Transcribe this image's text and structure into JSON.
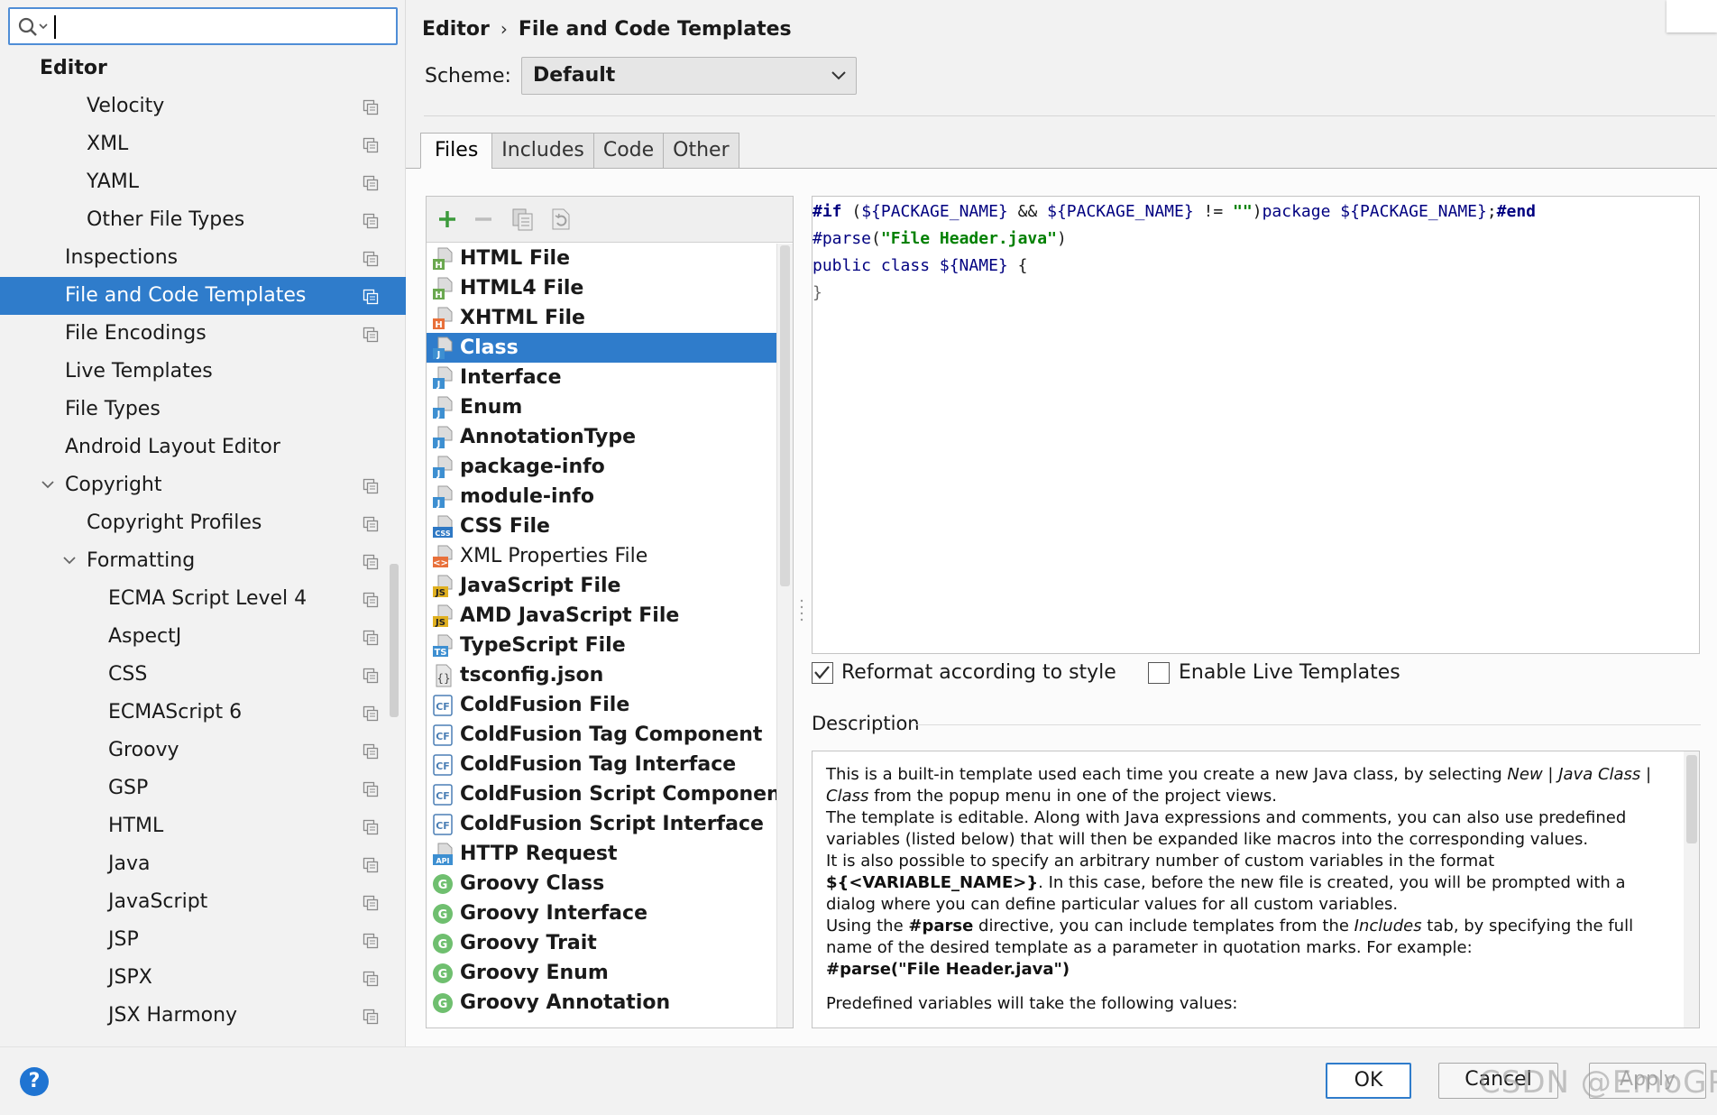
{
  "search": {
    "value": ""
  },
  "sidebar": {
    "items": [
      {
        "label": "Editor",
        "bold": true,
        "indent": 1,
        "proj": false
      },
      {
        "label": "Velocity",
        "indent": 3,
        "proj": true
      },
      {
        "label": "XML",
        "indent": 3,
        "proj": true
      },
      {
        "label": "YAML",
        "indent": 3,
        "proj": true
      },
      {
        "label": "Other File Types",
        "indent": 3,
        "proj": true
      },
      {
        "label": "Inspections",
        "indent": 2,
        "proj": true
      },
      {
        "label": "File and Code Templates",
        "indent": 2,
        "proj": true,
        "selected": true
      },
      {
        "label": "File Encodings",
        "indent": 2,
        "proj": true
      },
      {
        "label": "Live Templates",
        "indent": 2,
        "proj": false
      },
      {
        "label": "File Types",
        "indent": 2,
        "proj": false
      },
      {
        "label": "Android Layout Editor",
        "indent": 2,
        "proj": false
      },
      {
        "label": "Copyright",
        "indent": 2,
        "proj": true,
        "expanded": true
      },
      {
        "label": "Copyright Profiles",
        "indent": 3,
        "proj": true
      },
      {
        "label": "Formatting",
        "indent": 3,
        "proj": true,
        "expanded": true
      },
      {
        "label": "ECMA Script Level 4",
        "indent": 4,
        "proj": true
      },
      {
        "label": "AspectJ",
        "indent": 4,
        "proj": true
      },
      {
        "label": "CSS",
        "indent": 4,
        "proj": true
      },
      {
        "label": "ECMAScript 6",
        "indent": 4,
        "proj": true
      },
      {
        "label": "Groovy",
        "indent": 4,
        "proj": true
      },
      {
        "label": "GSP",
        "indent": 4,
        "proj": true
      },
      {
        "label": "HTML",
        "indent": 4,
        "proj": true
      },
      {
        "label": "Java",
        "indent": 4,
        "proj": true
      },
      {
        "label": "JavaScript",
        "indent": 4,
        "proj": true
      },
      {
        "label": "JSP",
        "indent": 4,
        "proj": true
      },
      {
        "label": "JSPX",
        "indent": 4,
        "proj": true
      },
      {
        "label": "JSX Harmony",
        "indent": 4,
        "proj": true
      }
    ]
  },
  "header": {
    "breadcrumb": [
      "Editor",
      "File and Code Templates"
    ],
    "breadcrumb_sep": "›",
    "scheme_label": "Scheme:",
    "scheme_value": "Default"
  },
  "tabs": [
    {
      "label": "Files",
      "active": true
    },
    {
      "label": "Includes"
    },
    {
      "label": "Code"
    },
    {
      "label": "Other"
    }
  ],
  "templates": [
    {
      "name": "HTML File",
      "icon": "html-file-icon",
      "badge": "H",
      "color": "#6aa84f"
    },
    {
      "name": "HTML4 File",
      "icon": "html-file-icon",
      "badge": "H",
      "color": "#6aa84f"
    },
    {
      "name": "XHTML File",
      "icon": "xhtml-file-icon",
      "badge": "H",
      "color": "#e8703a"
    },
    {
      "name": "Class",
      "icon": "java-file-icon",
      "badge": "J",
      "color": "#3d8fd1",
      "selected": true
    },
    {
      "name": "Interface",
      "icon": "java-file-icon",
      "badge": "J",
      "color": "#3d8fd1"
    },
    {
      "name": "Enum",
      "icon": "java-file-icon",
      "badge": "J",
      "color": "#3d8fd1"
    },
    {
      "name": "AnnotationType",
      "icon": "java-file-icon",
      "badge": "J",
      "color": "#3d8fd1"
    },
    {
      "name": "package-info",
      "icon": "java-file-icon",
      "badge": "J",
      "color": "#3d8fd1"
    },
    {
      "name": "module-info",
      "icon": "java-file-icon",
      "badge": "J",
      "color": "#3d8fd1"
    },
    {
      "name": "CSS File",
      "icon": "css-file-icon",
      "badge": "CSS",
      "color": "#2e78c4"
    },
    {
      "name": "XML Properties File",
      "icon": "xml-file-icon",
      "badge": "<>",
      "color": "#e8703a",
      "plain": true
    },
    {
      "name": "JavaScript File",
      "icon": "js-file-icon",
      "badge": "JS",
      "color": "#e0b020"
    },
    {
      "name": "AMD JavaScript File",
      "icon": "js-file-icon",
      "badge": "JS",
      "color": "#e0b020"
    },
    {
      "name": "TypeScript File",
      "icon": "ts-file-icon",
      "badge": "TS",
      "color": "#3d8fd1"
    },
    {
      "name": "tsconfig.json",
      "icon": "json-file-icon",
      "badge": "{}",
      "color": "#777777"
    },
    {
      "name": "ColdFusion File",
      "icon": "coldfusion-icon",
      "badge": "CF",
      "color": "#4b7fb5"
    },
    {
      "name": "ColdFusion Tag Component",
      "icon": "coldfusion-icon",
      "badge": "CF",
      "color": "#4b7fb5"
    },
    {
      "name": "ColdFusion Tag Interface",
      "icon": "coldfusion-icon",
      "badge": "CF",
      "color": "#4b7fb5"
    },
    {
      "name": "ColdFusion Script Component",
      "icon": "coldfusion-icon",
      "badge": "CF",
      "color": "#4b7fb5"
    },
    {
      "name": "ColdFusion Script Interface",
      "icon": "coldfusion-icon",
      "badge": "CF",
      "color": "#4b7fb5"
    },
    {
      "name": "HTTP Request",
      "icon": "http-request-icon",
      "badge": "API",
      "color": "#3d8fd1"
    },
    {
      "name": "Groovy Class",
      "icon": "groovy-icon",
      "badge": "G",
      "color": "#6fbf6f",
      "round": true
    },
    {
      "name": "Groovy Interface",
      "icon": "groovy-icon",
      "badge": "G",
      "color": "#6fbf6f",
      "round": true
    },
    {
      "name": "Groovy Trait",
      "icon": "groovy-icon",
      "badge": "G",
      "color": "#6fbf6f",
      "round": true
    },
    {
      "name": "Groovy Enum",
      "icon": "groovy-icon",
      "badge": "G",
      "color": "#6fbf6f",
      "round": true
    },
    {
      "name": "Groovy Annotation",
      "icon": "groovy-icon",
      "badge": "G",
      "color": "#6fbf6f",
      "round": true
    }
  ],
  "editor": {
    "lines": [
      [
        [
          "kw",
          "#if"
        ],
        [
          "plain",
          " ("
        ],
        [
          "var",
          "${PACKAGE_NAME}"
        ],
        [
          "plain",
          " && "
        ],
        [
          "var",
          "${PACKAGE_NAME}"
        ],
        [
          "plain",
          " != "
        ],
        [
          "str",
          "\"\""
        ],
        [
          "plain",
          ")"
        ],
        [
          "var",
          "package ${PACKAGE_NAME}"
        ],
        [
          "plain",
          ";"
        ],
        [
          "kw",
          "#end"
        ]
      ],
      [
        [
          "var",
          "#parse"
        ],
        [
          "plain",
          "("
        ],
        [
          "str",
          "\"File Header.java\""
        ],
        [
          "plain",
          ")"
        ]
      ],
      [
        [
          "var",
          "public class ${NAME}"
        ],
        [
          "plain",
          " {"
        ]
      ],
      [
        [
          "dim",
          "}"
        ]
      ]
    ]
  },
  "options": {
    "reformat_label": "Reformat according to style",
    "reformat_checked": true,
    "live_label": "Enable Live Templates",
    "live_checked": false
  },
  "description": {
    "title": "Description",
    "paragraphs": [
      [
        [
          "t",
          "This is a built-in template used each time you create a new Java class, by selecting "
        ],
        [
          "i",
          "New"
        ],
        [
          "t",
          " | "
        ],
        [
          "i",
          "Java Class"
        ],
        [
          "t",
          " | "
        ],
        [
          "i",
          "Class"
        ],
        [
          "t",
          " from the popup menu in one of the project views."
        ]
      ],
      [
        [
          "t",
          "The template is editable. Along with Java expressions and comments, you can also use predefined variables (listed below) that will then be expanded like macros into the corresponding values."
        ]
      ],
      [
        [
          "t",
          "It is also possible to specify an arbitrary number of custom variables in the format "
        ],
        [
          "b",
          "${<VARIABLE_NAME>}"
        ],
        [
          "t",
          ". In this case, before the new file is created, you will be prompted with a dialog where you can define particular values for all custom variables."
        ]
      ],
      [
        [
          "t",
          "Using the "
        ],
        [
          "b",
          "#parse"
        ],
        [
          "t",
          " directive, you can include templates from the "
        ],
        [
          "i",
          "Includes"
        ],
        [
          "t",
          " tab, by specifying the full name of the desired template as a parameter in quotation marks. For example:"
        ]
      ],
      [
        [
          "b",
          "#parse(\"File Header.java\")"
        ]
      ],
      [
        [
          "t",
          "Predefined variables will take the following values:"
        ]
      ]
    ]
  },
  "footer": {
    "help": "?",
    "ok": "OK",
    "cancel": "Cancel",
    "apply": "Apply",
    "watermark": "CSDN @EmoGP"
  },
  "colors": {
    "selection": "#2f7ccb",
    "accent": "#4f8dd6",
    "keyword": "#000080",
    "string": "#008000"
  }
}
